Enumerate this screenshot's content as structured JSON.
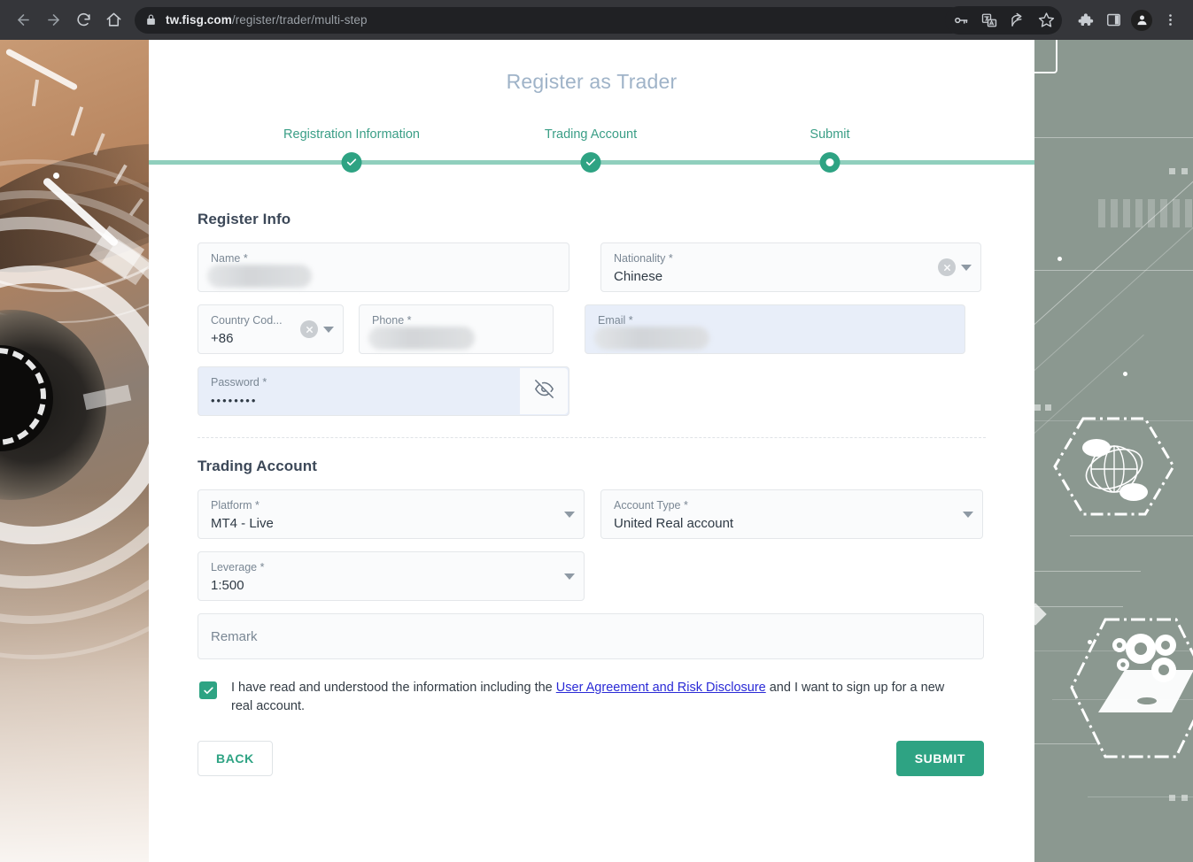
{
  "browser": {
    "url_host": "tw.fisg.com",
    "url_path": "/register/trader/multi-step",
    "nav": {
      "back": "back-arrow",
      "forward": "forward-arrow",
      "reload": "reload",
      "home": "home"
    },
    "toolbar_icons": [
      "password-key-icon",
      "translate-icon",
      "share-icon",
      "bookmark-star-icon",
      "extensions-puzzle-icon",
      "side-panel-icon",
      "profile-avatar-icon",
      "three-dot-menu-icon"
    ]
  },
  "header": {
    "title": "Register as Trader"
  },
  "stepper": {
    "steps": [
      {
        "label": "Registration Information",
        "state": "complete"
      },
      {
        "label": "Trading Account",
        "state": "complete"
      },
      {
        "label": "Submit",
        "state": "current"
      }
    ]
  },
  "register_info": {
    "section_title": "Register Info",
    "fields": {
      "name": {
        "label": "Name *",
        "value": "",
        "redacted": true
      },
      "nationality": {
        "label": "Nationality *",
        "value": "Chinese",
        "redacted": false
      },
      "country_code": {
        "label": "Country Cod...",
        "value": "+86",
        "redacted": false
      },
      "phone": {
        "label": "Phone *",
        "value": "",
        "redacted": true
      },
      "email": {
        "label": "Email *",
        "value": "",
        "redacted": true
      },
      "password": {
        "label": "Password *",
        "value": "••••••••",
        "redacted": false
      }
    }
  },
  "trading_account": {
    "section_title": "Trading Account",
    "fields": {
      "platform": {
        "label": "Platform *",
        "value": "MT4 - Live"
      },
      "account_type": {
        "label": "Account Type *",
        "value": "United Real account"
      },
      "leverage": {
        "label": "Leverage *",
        "value": "1:500"
      }
    },
    "remark": {
      "placeholder": "Remark",
      "value": ""
    }
  },
  "agreement": {
    "checked": true,
    "text_before": "I have read and understood the information including the ",
    "link_text": "User Agreement and Risk Disclosure",
    "text_after": " and I want to sign up for a new real account."
  },
  "actions": {
    "back_label": "BACK",
    "submit_label": "SUBMIT"
  },
  "colors": {
    "accent": "#2ea383",
    "track": "#90cfbd",
    "title": "#9fb3c8",
    "link": "#2a2ad6",
    "focus_bg": "#e8eef9"
  }
}
